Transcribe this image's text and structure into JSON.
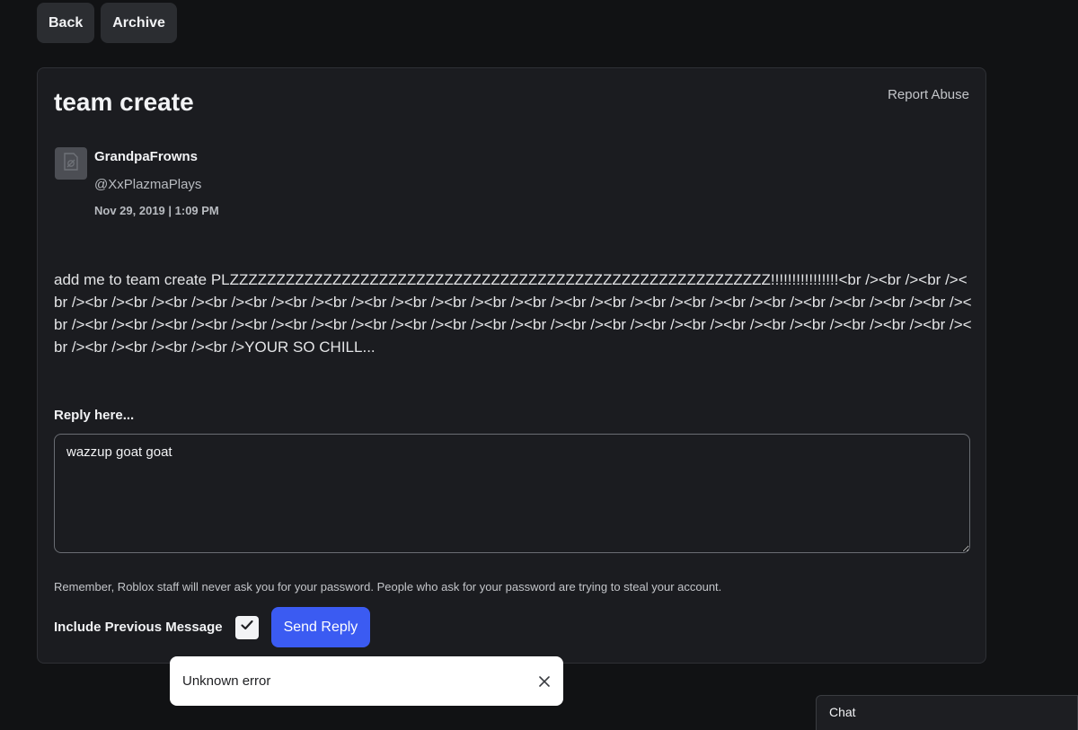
{
  "toolbar": {
    "back_label": "Back",
    "archive_label": "Archive"
  },
  "message": {
    "title": "team create",
    "report_label": "Report Abuse",
    "author_display_name": "GrandpaFrowns",
    "author_username": "@XxPlazmaPlays",
    "timestamp": "Nov 29, 2019 | 1:09 PM",
    "body": "add me to team create PLZZZZZZZZZZZZZZZZZZZZZZZZZZZZZZZZZZZZZZZZZZZZZZZZZZZZZZZZZZ!!!!!!!!!!!!!!!!<br /><br /><br /><br /><br /><br /><br /><br /><br /><br /><br /><br /><br /><br /><br /><br /><br /><br /><br /><br /><br /><br /><br /><br /><br /><br /><br /><br /><br /><br /><br /><br /><br /><br /><br /><br /><br /><br /><br /><br /><br /><br /><br /><br /><br /><br /><br /><br /><br /><br /><br /><br /><br /><br />YOUR SO CHILL..."
  },
  "reply": {
    "label": "Reply here...",
    "value": "wazzup goat goat",
    "warning": "Remember, Roblox staff will never ask you for your password. People who ask for your password are trying to steal your account.",
    "include_previous_label": "Include Previous Message",
    "include_previous_checked": true,
    "send_label": "Send Reply"
  },
  "toast": {
    "text": "Unknown error"
  },
  "chat": {
    "label": "Chat"
  },
  "colors": {
    "accent": "#3b5bf2",
    "background": "#111214",
    "card": "#1b1c20"
  },
  "icons": {
    "avatar": "image-placeholder-icon",
    "checkbox": "checkmark-icon",
    "toast_close": "close-icon"
  }
}
